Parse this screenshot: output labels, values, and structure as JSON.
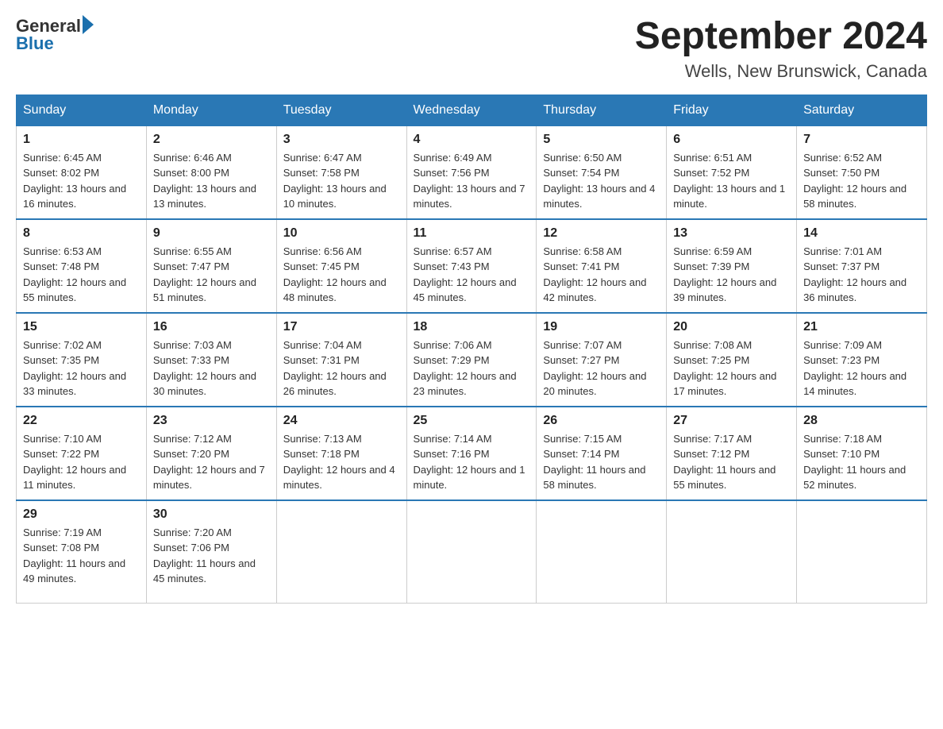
{
  "logo": {
    "general": "General",
    "blue": "Blue"
  },
  "title": {
    "month_year": "September 2024",
    "location": "Wells, New Brunswick, Canada"
  },
  "days_of_week": [
    "Sunday",
    "Monday",
    "Tuesday",
    "Wednesday",
    "Thursday",
    "Friday",
    "Saturday"
  ],
  "weeks": [
    [
      {
        "day": "1",
        "sunrise": "6:45 AM",
        "sunset": "8:02 PM",
        "daylight": "13 hours and 16 minutes."
      },
      {
        "day": "2",
        "sunrise": "6:46 AM",
        "sunset": "8:00 PM",
        "daylight": "13 hours and 13 minutes."
      },
      {
        "day": "3",
        "sunrise": "6:47 AM",
        "sunset": "7:58 PM",
        "daylight": "13 hours and 10 minutes."
      },
      {
        "day": "4",
        "sunrise": "6:49 AM",
        "sunset": "7:56 PM",
        "daylight": "13 hours and 7 minutes."
      },
      {
        "day": "5",
        "sunrise": "6:50 AM",
        "sunset": "7:54 PM",
        "daylight": "13 hours and 4 minutes."
      },
      {
        "day": "6",
        "sunrise": "6:51 AM",
        "sunset": "7:52 PM",
        "daylight": "13 hours and 1 minute."
      },
      {
        "day": "7",
        "sunrise": "6:52 AM",
        "sunset": "7:50 PM",
        "daylight": "12 hours and 58 minutes."
      }
    ],
    [
      {
        "day": "8",
        "sunrise": "6:53 AM",
        "sunset": "7:48 PM",
        "daylight": "12 hours and 55 minutes."
      },
      {
        "day": "9",
        "sunrise": "6:55 AM",
        "sunset": "7:47 PM",
        "daylight": "12 hours and 51 minutes."
      },
      {
        "day": "10",
        "sunrise": "6:56 AM",
        "sunset": "7:45 PM",
        "daylight": "12 hours and 48 minutes."
      },
      {
        "day": "11",
        "sunrise": "6:57 AM",
        "sunset": "7:43 PM",
        "daylight": "12 hours and 45 minutes."
      },
      {
        "day": "12",
        "sunrise": "6:58 AM",
        "sunset": "7:41 PM",
        "daylight": "12 hours and 42 minutes."
      },
      {
        "day": "13",
        "sunrise": "6:59 AM",
        "sunset": "7:39 PM",
        "daylight": "12 hours and 39 minutes."
      },
      {
        "day": "14",
        "sunrise": "7:01 AM",
        "sunset": "7:37 PM",
        "daylight": "12 hours and 36 minutes."
      }
    ],
    [
      {
        "day": "15",
        "sunrise": "7:02 AM",
        "sunset": "7:35 PM",
        "daylight": "12 hours and 33 minutes."
      },
      {
        "day": "16",
        "sunrise": "7:03 AM",
        "sunset": "7:33 PM",
        "daylight": "12 hours and 30 minutes."
      },
      {
        "day": "17",
        "sunrise": "7:04 AM",
        "sunset": "7:31 PM",
        "daylight": "12 hours and 26 minutes."
      },
      {
        "day": "18",
        "sunrise": "7:06 AM",
        "sunset": "7:29 PM",
        "daylight": "12 hours and 23 minutes."
      },
      {
        "day": "19",
        "sunrise": "7:07 AM",
        "sunset": "7:27 PM",
        "daylight": "12 hours and 20 minutes."
      },
      {
        "day": "20",
        "sunrise": "7:08 AM",
        "sunset": "7:25 PM",
        "daylight": "12 hours and 17 minutes."
      },
      {
        "day": "21",
        "sunrise": "7:09 AM",
        "sunset": "7:23 PM",
        "daylight": "12 hours and 14 minutes."
      }
    ],
    [
      {
        "day": "22",
        "sunrise": "7:10 AM",
        "sunset": "7:22 PM",
        "daylight": "12 hours and 11 minutes."
      },
      {
        "day": "23",
        "sunrise": "7:12 AM",
        "sunset": "7:20 PM",
        "daylight": "12 hours and 7 minutes."
      },
      {
        "day": "24",
        "sunrise": "7:13 AM",
        "sunset": "7:18 PM",
        "daylight": "12 hours and 4 minutes."
      },
      {
        "day": "25",
        "sunrise": "7:14 AM",
        "sunset": "7:16 PM",
        "daylight": "12 hours and 1 minute."
      },
      {
        "day": "26",
        "sunrise": "7:15 AM",
        "sunset": "7:14 PM",
        "daylight": "11 hours and 58 minutes."
      },
      {
        "day": "27",
        "sunrise": "7:17 AM",
        "sunset": "7:12 PM",
        "daylight": "11 hours and 55 minutes."
      },
      {
        "day": "28",
        "sunrise": "7:18 AM",
        "sunset": "7:10 PM",
        "daylight": "11 hours and 52 minutes."
      }
    ],
    [
      {
        "day": "29",
        "sunrise": "7:19 AM",
        "sunset": "7:08 PM",
        "daylight": "11 hours and 49 minutes."
      },
      {
        "day": "30",
        "sunrise": "7:20 AM",
        "sunset": "7:06 PM",
        "daylight": "11 hours and 45 minutes."
      },
      null,
      null,
      null,
      null,
      null
    ]
  ]
}
